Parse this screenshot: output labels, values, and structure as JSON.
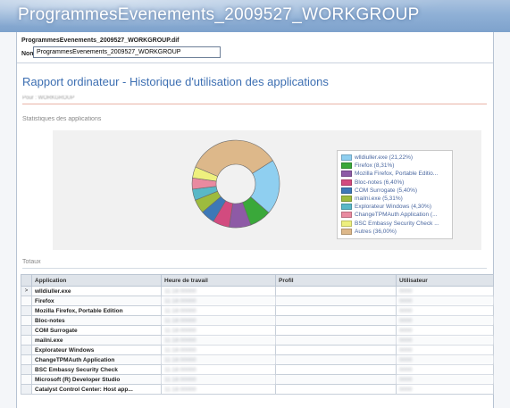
{
  "window": {
    "title": "ProgrammesEvenements_2009527_WORKGROUP"
  },
  "header": {
    "path": "ProgrammesEvenements_2009527_WORKGROUP.dif",
    "nom_label": "Nom",
    "nom_value": "ProgrammesEvenements_2009527_WORKGROUP"
  },
  "report": {
    "title": "Rapport ordinateur - Historique d'utilisation des applications",
    "subtitle": "Pour : WORKGROUP"
  },
  "sections": {
    "stats": "Statistiques des applications",
    "totals": "Totaux"
  },
  "chart_data": {
    "type": "pie",
    "categories": [
      "wlldiuller.exe",
      "Firefox",
      "Mozilla Firefox, Portable Edition",
      "Bloc-notes",
      "COM Surrogate",
      "mailni.exe",
      "Explorateur Windows",
      "ChangeTPMAuth Application",
      "BSC Embassy Security Check",
      "Autres"
    ],
    "values": [
      21.22,
      8.31,
      8.31,
      6.4,
      5.4,
      5.31,
      4.3,
      4.3,
      4.3,
      36.0
    ],
    "labels": [
      "wlldiuller.exe (21,22%)",
      "Firefox (8,31%)",
      "Mozilla Firefox, Portable Editio...",
      "Bloc-notes (6,40%)",
      "COM Surrogate (5,40%)",
      "mailni.exe (5,31%)",
      "Explorateur Windows (4,30%)",
      "ChangeTPMAuth Application (...",
      "BSC Embassy Security Check ...",
      "Autres (36,00%)"
    ],
    "colors": [
      "#8fcff0",
      "#3aa83a",
      "#8e5aa6",
      "#d24b7f",
      "#3d78b7",
      "#9dbb3e",
      "#59b8c7",
      "#e98aa0",
      "#eef07e",
      "#ddb88a"
    ]
  },
  "table": {
    "columns": [
      "Application",
      "Heure de travail",
      "Profil",
      "Utilisateur"
    ],
    "rows": [
      {
        "marker": ">",
        "app": "wlldiuller.exe",
        "time": "11:18:00000",
        "profile": "",
        "user": "0000"
      },
      {
        "marker": "",
        "app": "Firefox",
        "time": "11:18:00000",
        "profile": "",
        "user": "0000"
      },
      {
        "marker": "",
        "app": "Mozilla Firefox, Portable Edition",
        "time": "11:18:00000",
        "profile": "",
        "user": "0000"
      },
      {
        "marker": "",
        "app": "Bloc-notes",
        "time": "11:18:00000",
        "profile": "",
        "user": "0000"
      },
      {
        "marker": "",
        "app": "COM Surrogate",
        "time": "11:18:00000",
        "profile": "",
        "user": "0000"
      },
      {
        "marker": "",
        "app": "mailni.exe",
        "time": "11:18:00000",
        "profile": "",
        "user": "0000"
      },
      {
        "marker": "",
        "app": "Explorateur Windows",
        "time": "11:18:00000",
        "profile": "",
        "user": "0000"
      },
      {
        "marker": "",
        "app": "ChangeTPMAuth Application",
        "time": "11:18:00000",
        "profile": "",
        "user": "0000"
      },
      {
        "marker": "",
        "app": "BSC Embassy Security Check",
        "time": "11:18:00000",
        "profile": "",
        "user": "0000"
      },
      {
        "marker": "",
        "app": "Microsoft (R) Developer Studio",
        "time": "11:18:00000",
        "profile": "",
        "user": "0000"
      },
      {
        "marker": "",
        "app": "Catalyst Control Center: Host app...",
        "time": "11:18:00000",
        "profile": "",
        "user": "0000"
      }
    ]
  }
}
